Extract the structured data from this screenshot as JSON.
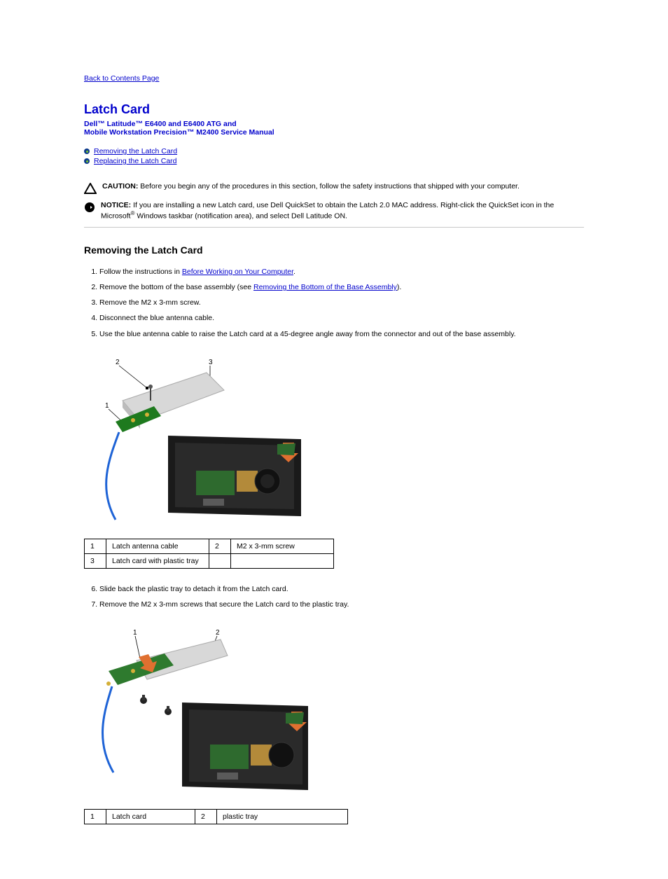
{
  "back_link": "Back to Contents Page",
  "heading": "Latch Card",
  "subheading_line1": "Dell™ Latitude™ E6400 and E6400 ATG and",
  "subheading_line2": "Mobile Workstation Precision™ M2400 Service Manual",
  "bullets": {
    "items": [
      {
        "label": "Removing the Latch Card"
      },
      {
        "label": "Replacing the Latch Card"
      }
    ]
  },
  "caution": {
    "label": "CAUTION:",
    "text": "Before you begin any of the procedures in this section, follow the safety instructions that shipped with your computer."
  },
  "notice": {
    "label": "NOTICE:",
    "text_before": "If you are installing a new Latch card, use Dell QuickSet to obtain the Latch 2.0 MAC address. Right-click the QuickSet icon in the Microsoft",
    "text_after": " Windows taskbar (notification area), and select Dell Latitude ON."
  },
  "notice_registered": "®",
  "section1": {
    "title": "Removing the Latch Card",
    "steps": [
      {
        "prefix": "Follow the instructions in ",
        "link": "Before Working on Your Computer",
        "suffix": "."
      },
      {
        "prefix": "Remove the bottom of the base assembly (see ",
        "link": "Removing the Bottom of the Base Assembly",
        "suffix": ")."
      },
      {
        "prefix": "Remove the M2 x 3-mm screw.",
        "link": "",
        "suffix": ""
      },
      {
        "prefix": "Disconnect the blue antenna cable.",
        "link": "",
        "suffix": ""
      },
      {
        "prefix": "Use the blue antenna cable to raise the Latch card at a 45-degree angle away from the connector and out of the base assembly.",
        "link": "",
        "suffix": ""
      }
    ]
  },
  "table1": {
    "rows": [
      [
        "1",
        "Latch antenna cable",
        "2",
        "M2 x 3-mm screw"
      ],
      [
        "3",
        "Latch card with plastic tray",
        "",
        ""
      ]
    ]
  },
  "step6": {
    "prefix": "Slide back the plastic tray to detach it from the Latch card.",
    "link": "",
    "suffix": ""
  },
  "step7": {
    "prefix": "Remove the M2 x 3-mm screws that secure the Latch card to the plastic tray.",
    "link": "",
    "suffix": ""
  },
  "table2": {
    "rows": [
      [
        "1",
        "Latch card",
        "2",
        "plastic tray"
      ]
    ]
  },
  "figure1": {
    "alt": "Latch card removal illustration showing antenna cable, screw, and card tray over base assembly"
  },
  "figure2": {
    "alt": "Latch card detached from plastic tray over base assembly"
  }
}
